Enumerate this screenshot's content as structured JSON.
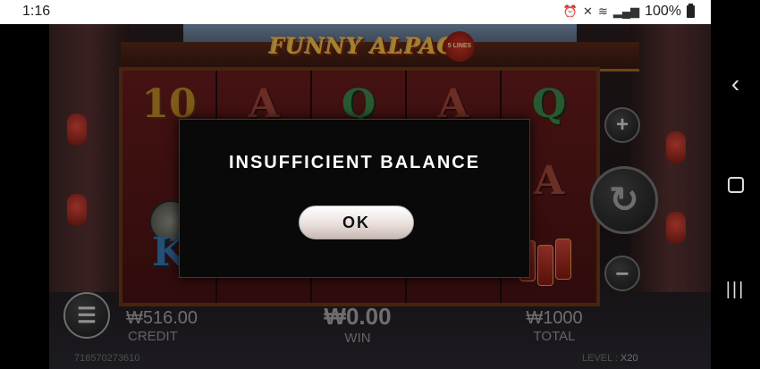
{
  "status_bar": {
    "time": "1:16",
    "battery": "100%",
    "icons": [
      "alarm-icon",
      "mute-icon",
      "wifi-icon",
      "signal-icon",
      "battery-icon"
    ]
  },
  "nav_bar": {
    "back_icon": "‹",
    "recent_icon": "|||"
  },
  "game": {
    "logo": "FUNNY ALPACA",
    "lines_badge": "5 LINES",
    "reels": [
      [
        "10",
        "",
        "K"
      ],
      [
        "A",
        "",
        ""
      ],
      [
        "Q",
        "",
        ""
      ],
      [
        "A",
        "",
        ""
      ],
      [
        "Q",
        "A",
        ""
      ]
    ],
    "credit_value": "₩516.00",
    "credit_label": "CREDIT",
    "win_value": "₩0.00",
    "win_label": "WIN",
    "total_value": "₩1000",
    "total_label": "TOTAL",
    "game_id": "716570273610",
    "level_label": "LEVEL :",
    "level_value": "X20",
    "plus_symbol": "+",
    "minus_symbol": "−",
    "spin_symbol": "↻",
    "menu_symbol": "☰"
  },
  "modal": {
    "title": "INSUFFICIENT BALANCE",
    "ok_label": "OK"
  },
  "colors": {
    "modal_bg": "#090909",
    "ok_button": "#ffffff",
    "symbol_gold": "#c48a2a",
    "symbol_green": "#3c8a4a"
  }
}
